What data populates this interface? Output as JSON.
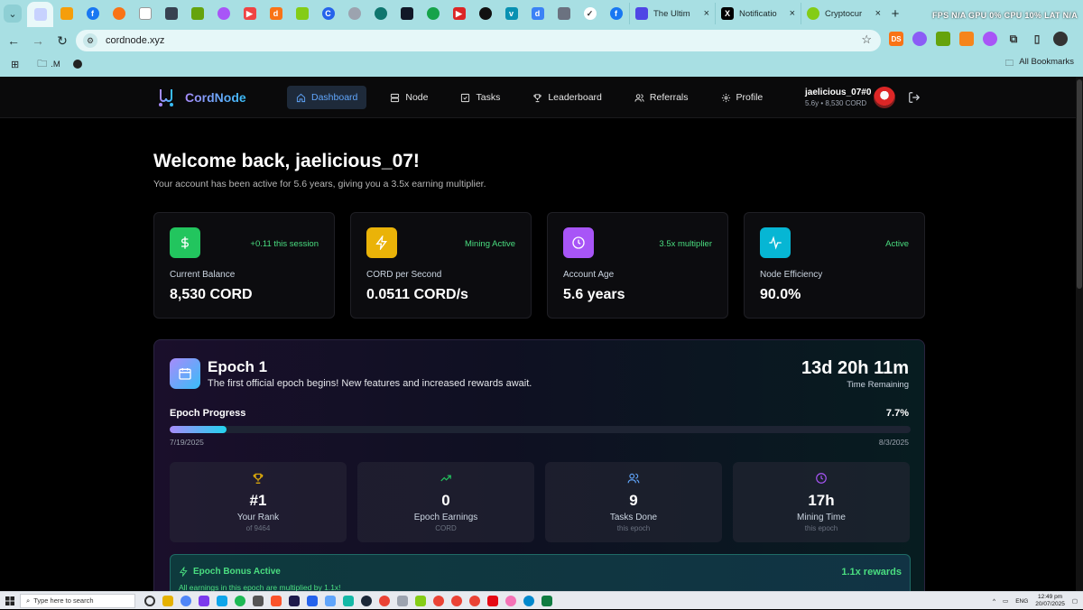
{
  "browser": {
    "tabs": [
      {
        "label": "The Ultim",
        "icon": "m-icon"
      },
      {
        "label": "Notificatio",
        "icon": "x-icon"
      },
      {
        "label": "Cryptocur",
        "icon": "coin-icon"
      }
    ],
    "url": "cordnode.xyz",
    "bookmarks": {
      "folder": ".M",
      "all": "All Bookmarks"
    },
    "hud": "FPS N/A GPU 0% CPU 10% LAT N/A"
  },
  "nav": {
    "brand": "CordNode",
    "links": [
      {
        "label": "Dashboard"
      },
      {
        "label": "Node"
      },
      {
        "label": "Tasks"
      },
      {
        "label": "Leaderboard"
      },
      {
        "label": "Referrals"
      },
      {
        "label": "Profile"
      }
    ],
    "user": {
      "name": "jaelicious_07#0",
      "meta": "5.6y • 8,530 CORD"
    }
  },
  "welcome": {
    "title": "Welcome back, jaelicious_07!",
    "subtitle": "Your account has been active for 5.6 years, giving you a 3.5x earning multiplier."
  },
  "stats": [
    {
      "label": "Current Balance",
      "value": "8,530 CORD",
      "badge": "+0.11 this session",
      "icon": "dollar-icon",
      "color": "#22c55e"
    },
    {
      "label": "CORD per Second",
      "value": "0.0511 CORD/s",
      "badge": "Mining Active",
      "icon": "lightning-icon",
      "color": "#eab308"
    },
    {
      "label": "Account Age",
      "value": "5.6 years",
      "badge": "3.5x multiplier",
      "icon": "clock-icon",
      "color": "#a855f7"
    },
    {
      "label": "Node Efficiency",
      "value": "90.0%",
      "badge": "Active",
      "icon": "activity-icon",
      "color": "#06b6d4"
    }
  ],
  "epoch": {
    "title": "Epoch 1",
    "description": "The first official epoch begins! New features and increased rewards await.",
    "time_remaining": "13d 20h 11m",
    "time_label": "Time Remaining",
    "progress_label": "Epoch Progress",
    "progress_text": "7.7%",
    "progress": 7.7,
    "start_date": "7/19/2025",
    "end_date": "8/3/2025",
    "metrics": [
      {
        "value": "#1",
        "label": "Your Rank",
        "sub": "of 9464",
        "icon": "trophy-icon",
        "color": "#eab308"
      },
      {
        "value": "0",
        "label": "Epoch Earnings",
        "sub": "CORD",
        "icon": "trending-up-icon",
        "color": "#22c55e"
      },
      {
        "value": "9",
        "label": "Tasks Done",
        "sub": "this epoch",
        "icon": "users-icon",
        "color": "#60a5fa"
      },
      {
        "value": "17h",
        "label": "Mining Time",
        "sub": "this epoch",
        "icon": "clock-icon",
        "color": "#a855f7"
      }
    ],
    "bonus": {
      "title": "Epoch Bonus Active",
      "description": "All earnings in this epoch are multiplied by 1.1x!",
      "rate": "1.1x rewards"
    }
  },
  "taskbar": {
    "search_placeholder": "Type here to search",
    "language": "ENG",
    "time": "12:49 pm",
    "date": "20/07/2025"
  }
}
